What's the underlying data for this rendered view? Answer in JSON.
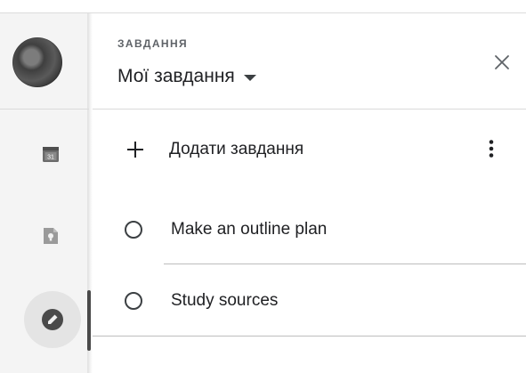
{
  "header": {
    "section_label": "ЗАВДАННЯ",
    "list_name": "Мої завдання"
  },
  "actions": {
    "add_task_label": "Додати завдання"
  },
  "tasks": [
    {
      "title": "Make an outline plan",
      "completed": false
    },
    {
      "title": "Study sources",
      "completed": false
    }
  ],
  "rail": {
    "calendar_day": "31",
    "items": [
      "calendar-icon",
      "keep-icon",
      "tasks-icon"
    ],
    "active": "tasks-icon"
  },
  "colors": {
    "text": "#202124",
    "muted": "#5f6368",
    "rail_bg": "#f4f4f4",
    "divider": "#dadada"
  }
}
